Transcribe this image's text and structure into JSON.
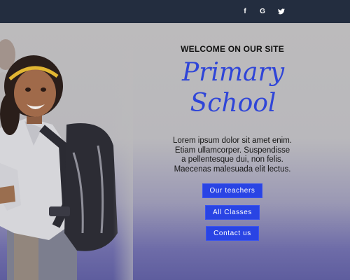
{
  "header": {
    "social": [
      {
        "icon": "facebook-icon",
        "glyph": "f"
      },
      {
        "icon": "google-icon",
        "glyph": "G"
      },
      {
        "icon": "twitter-icon",
        "glyph": "🐦"
      }
    ]
  },
  "hero": {
    "welcome": "WELCOME ON OUR SITE",
    "title_line1": "Primary",
    "title_line2": "School",
    "description_lines": [
      "Lorem ipsum dolor sit amet enim.",
      "Etiam ullamcorper. Suspendisse",
      "a pellentesque dui, non felis.",
      "Maecenas malesuada elit lectus."
    ],
    "buttons": [
      {
        "label": "Our teachers"
      },
      {
        "label": "All Classes"
      },
      {
        "label": "Contact us"
      }
    ]
  },
  "colors": {
    "topbar": "#232d3f",
    "accent": "#2f45d8",
    "button": "#2944e4"
  }
}
